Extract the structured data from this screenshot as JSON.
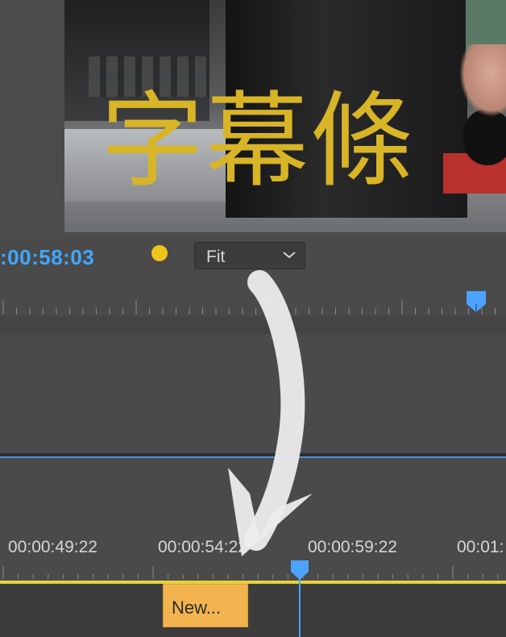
{
  "program_monitor": {
    "subtitle_text": "字幕條",
    "timecode": ":00:58:03",
    "fit_select": {
      "value": "Fit"
    },
    "indicator_color": "#f0c419",
    "subtitle_color": "#d8b427"
  },
  "timeline": {
    "ruler_labels": [
      "00:00:49:22",
      "00:00:54:22",
      "00:00:59:22",
      "00:01:"
    ],
    "clip": {
      "label": "New..."
    },
    "accent_color": "#4da3ff",
    "work_area_color": "#e6d23a"
  },
  "overlay": {
    "arrow": "curved-down-arrow-icon"
  }
}
